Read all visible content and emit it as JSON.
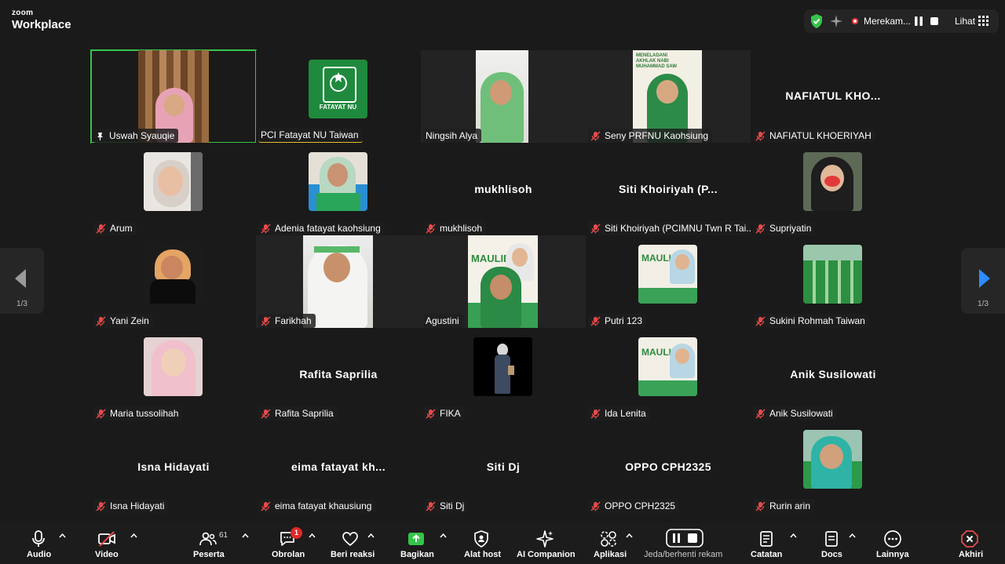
{
  "app": {
    "brand_top": "zoom",
    "brand_bottom": "Workplace"
  },
  "status": {
    "recording_label": "Merekam...",
    "view_label": "Lihat",
    "accent": "#35c44a",
    "record_color": "#e02828"
  },
  "pagination": {
    "left_page": "1/3",
    "right_page": "1/3"
  },
  "participants": [
    {
      "label": "Uswah Syauqie",
      "active": true,
      "pinned": true
    },
    {
      "label": "PCI Fatayat NU Taiwan",
      "logo_text": "FATAYAT NU"
    },
    {
      "label": "Ningsih  Alya"
    },
    {
      "label": "Seny PRFNU Kaohsiung",
      "poster_text": "MENELADANI AKHLAK NABI MUHAMMAD SAW"
    },
    {
      "label": "NAFIATUL KHOERIYAH",
      "display_name": "NAFIATUL  KHO..."
    },
    {
      "label": "Arum"
    },
    {
      "label": "Adenia fatayat kaohsiung"
    },
    {
      "label": "mukhlisoh",
      "display_name": "mukhlisoh"
    },
    {
      "label": "Siti Khoiriyah (PCIMNU Twn R Tai...",
      "display_name": "Siti  Khoiriyah  (P..."
    },
    {
      "label": "Supriyatin"
    },
    {
      "label": "Yani Zein"
    },
    {
      "label": "Farikhah"
    },
    {
      "label": "Agustini",
      "poster_text": "MAULID"
    },
    {
      "label": "Putri 123",
      "poster_text": "MAULID"
    },
    {
      "label": "Sukini Rohmah Taiwan"
    },
    {
      "label": "Maria tussolihah"
    },
    {
      "label": "Rafita Saprilia",
      "display_name": "Rafita Saprilia"
    },
    {
      "label": "FIKA"
    },
    {
      "label": "Ida Lenita",
      "poster_text": "MAULID"
    },
    {
      "label": "Anik Susilowati",
      "display_name": "Anik Susilowati"
    },
    {
      "label": "Isna Hidayati",
      "display_name": "Isna Hidayati"
    },
    {
      "label": "eima fatayat khausiung",
      "display_name": "eima  fatayat  kh..."
    },
    {
      "label": "Siti Dj",
      "display_name": "Siti Dj"
    },
    {
      "label": "OPPO CPH2325",
      "display_name": "OPPO CPH2325"
    },
    {
      "label": "Rurin arin"
    }
  ],
  "toolbar": {
    "audio": "Audio",
    "video": "Video",
    "participants": "Peserta",
    "participants_count": "61",
    "chat": "Obrolan",
    "chat_badge": "1",
    "reactions": "Beri reaksi",
    "share": "Bagikan",
    "host_tools": "Alat host",
    "ai_companion": "AI Companion",
    "apps": "Aplikasi",
    "record": "Jeda/berhenti rekam",
    "notes": "Catatan",
    "docs": "Docs",
    "more": "Lainnya",
    "end": "Akhiri"
  }
}
